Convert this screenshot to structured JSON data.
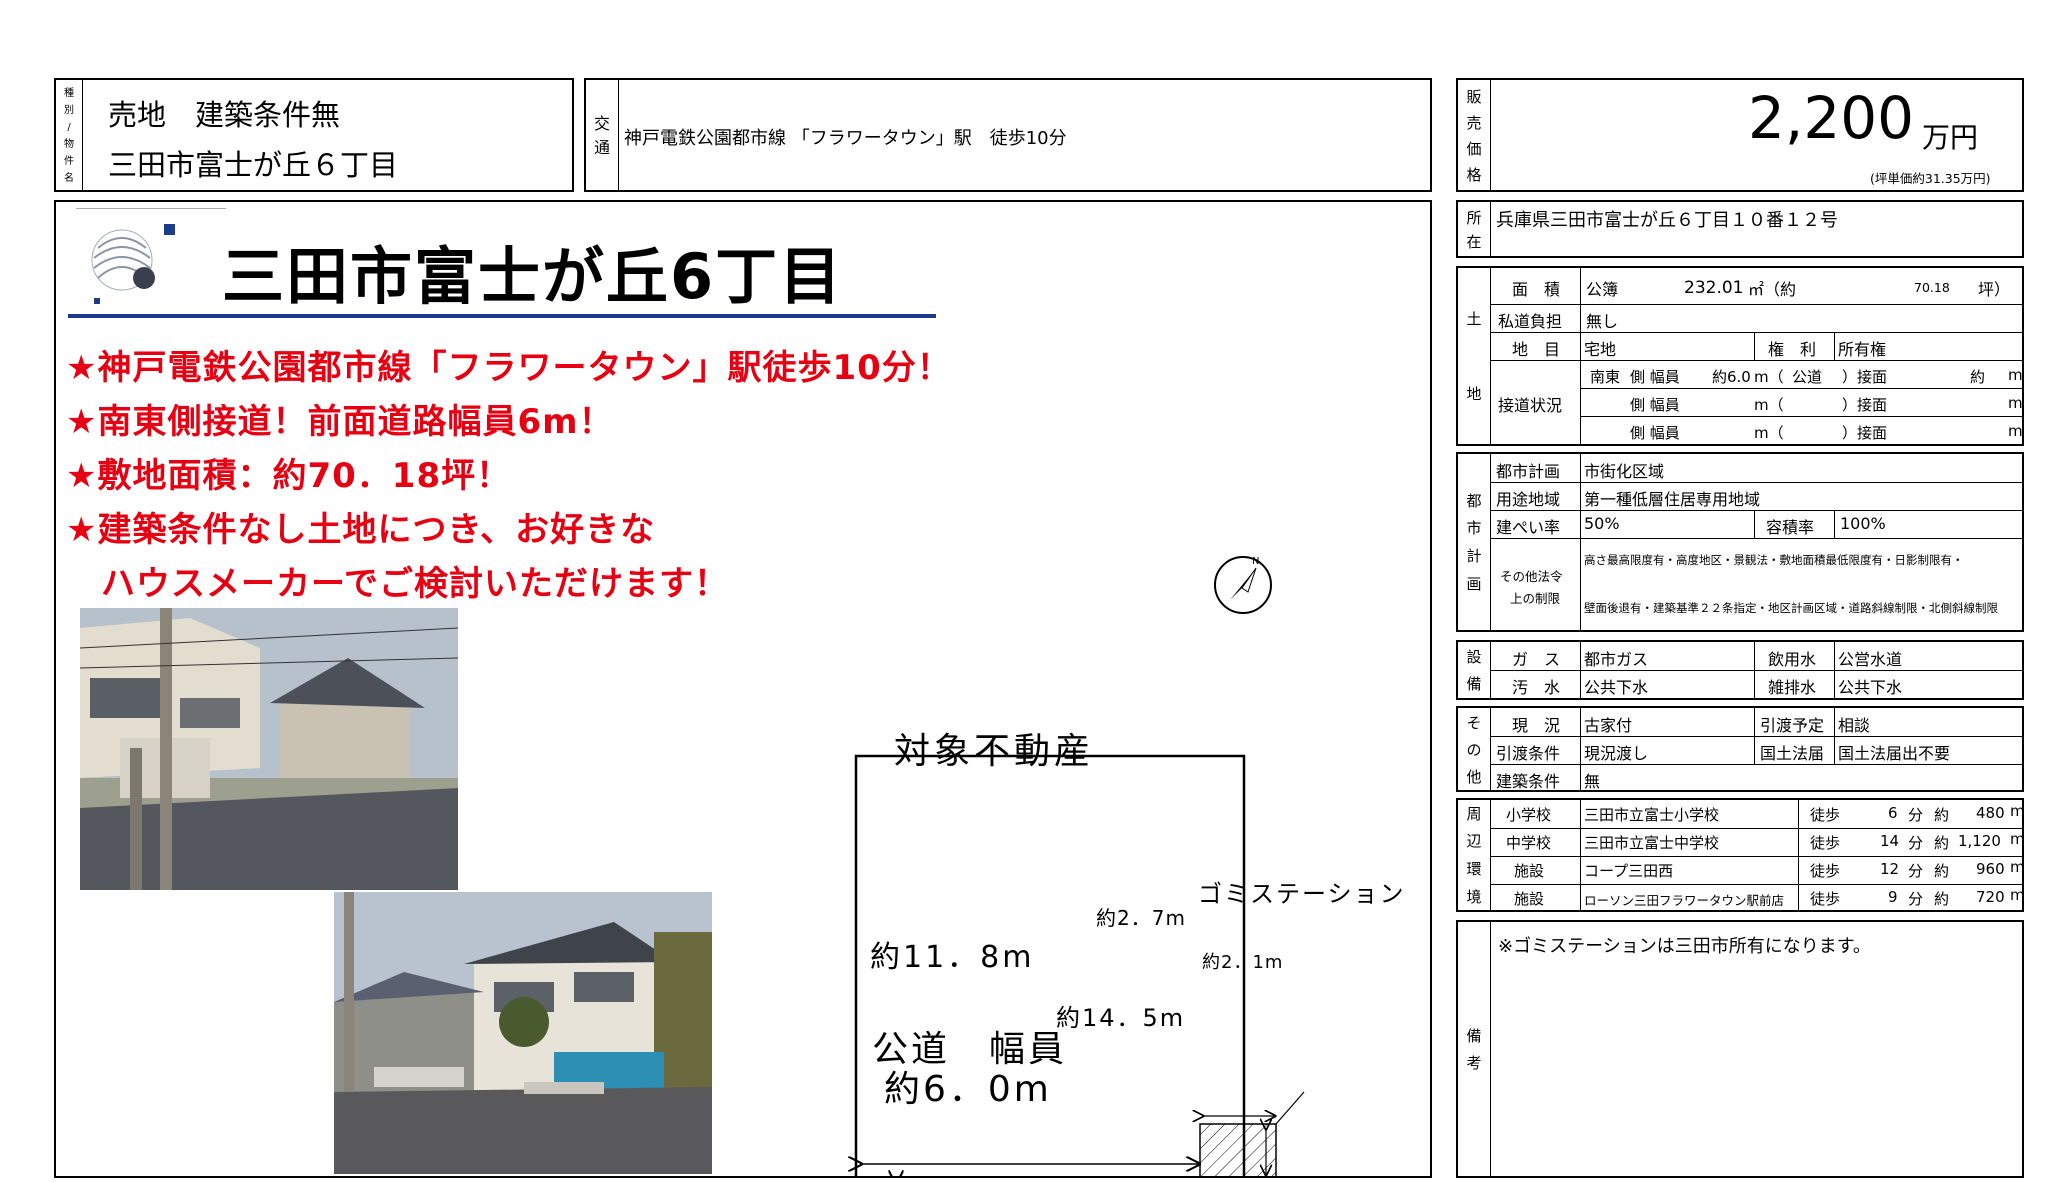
{
  "header": {
    "kind_label_chars": [
      "種",
      "別",
      "/",
      "物",
      "件",
      "名"
    ],
    "type": "売地　建築条件無",
    "name": "三田市富士が丘６丁目",
    "access_label_chars": [
      "交",
      "通"
    ],
    "access": "神戸電鉄公園都市線 「フラワータウン」駅　徒歩10分",
    "price_label_chars": [
      "販",
      "売",
      "価",
      "格"
    ],
    "price": "2,200",
    "price_unit": "万円",
    "price_note": "(坪単価約31.35万円)"
  },
  "main": {
    "title": "三田市富士が丘6丁目",
    "highlights": [
      "★神戸電鉄公園都市線「フラワータウン」駅徒歩10分！",
      "★南東側接道！前面道路幅員6m！",
      "★敷地面積：約70．18坪！",
      "★建築条件なし土地につき、お好きな",
      "　ハウスメーカーでご検討いただけます！"
    ],
    "plot_label": "対象不動産",
    "gomi_label": "ゴミステーション",
    "dim_width": "約11．8m",
    "dim_total": "約14．5m",
    "dim_gomi_w": "約2．7m",
    "dim_gomi_h": "約2．1m",
    "road_label1": "公道　幅員",
    "road_label2": "約6．0m",
    "compass_letter": "N"
  },
  "location": {
    "label_chars": [
      "所",
      "在"
    ],
    "value": "兵庫県三田市富士が丘６丁目１０番１２号"
  },
  "land": {
    "label_chars": [
      "土",
      "地"
    ],
    "area_label": "面　積",
    "area_type": "公簿",
    "area_value": "232.01",
    "area_unit": "㎡（約",
    "tsubo_value": "70.18",
    "tsubo_unit": "坪）",
    "private_road_label": "私道負担",
    "private_road_value": "無し",
    "chimoku_label": "地　目",
    "chimoku_value": "宅地",
    "rights_label": "権　利",
    "rights_value": "所有権",
    "road_label": "接道状況",
    "road_rows": [
      {
        "dir": "南東",
        "side": "側 幅員",
        "width": "約6.0",
        "m": "m（",
        "type": "公道",
        "close": "）接面",
        "approx": "約",
        "m2": "m"
      },
      {
        "dir": "",
        "side": "側 幅員",
        "width": "",
        "m": "m（",
        "type": "",
        "close": "）接面",
        "approx": "",
        "m2": "m"
      },
      {
        "dir": "",
        "side": "側 幅員",
        "width": "",
        "m": "m（",
        "type": "",
        "close": "）接面",
        "approx": "",
        "m2": "m"
      }
    ]
  },
  "plan": {
    "label_chars": [
      "都",
      "市",
      "計",
      "画"
    ],
    "city_plan_label": "都市計画",
    "city_plan_value": "市街化区域",
    "zoning_label": "用途地域",
    "zoning_value": "第一種低層住居専用地域",
    "bcr_label": "建ぺい率",
    "bcr_value": "50%",
    "far_label": "容積率",
    "far_value": "100%",
    "other_label1": "その他法令",
    "other_label2": "上の制限",
    "other_value1": "高さ最高限度有・高度地区・景観法・敷地面積最低限度有・日影制限有・",
    "other_value2": "壁面後退有・建築基準２２条指定・地区計画区域・道路斜線制限・北側斜線制限"
  },
  "facilities": {
    "label_chars": [
      "設",
      "備"
    ],
    "gas_label": "ガ　ス",
    "gas_value": "都市ガス",
    "water_label": "飲用水",
    "water_value": "公営水道",
    "sewage_label": "汚　水",
    "sewage_value": "公共下水",
    "drain_label": "雑排水",
    "drain_value": "公共下水"
  },
  "other": {
    "label_chars": [
      "そ",
      "の",
      "他"
    ],
    "status_label": "現　況",
    "status_value": "古家付",
    "handover_plan_label": "引渡予定",
    "handover_plan_value": "相談",
    "handover_cond_label": "引渡条件",
    "handover_cond_value": "現況渡し",
    "land_law_label": "国土法届",
    "land_law_value": "国土法届出不要",
    "build_cond_label": "建築条件",
    "build_cond_value": "無"
  },
  "surroundings": {
    "label_chars": [
      "周",
      "辺",
      "環",
      "境"
    ],
    "rows": [
      {
        "type": "小学校",
        "name": "三田市立富士小学校",
        "walk": "徒歩",
        "min": "6",
        "min_unit": "分",
        "approx": "約",
        "dist": "480",
        "unit": "m"
      },
      {
        "type": "中学校",
        "name": "三田市立富士中学校",
        "walk": "徒歩",
        "min": "14",
        "min_unit": "分",
        "approx": "約",
        "dist": "1,120",
        "unit": "m"
      },
      {
        "type": "施設",
        "name": "コープ三田西",
        "walk": "徒歩",
        "min": "12",
        "min_unit": "分",
        "approx": "約",
        "dist": "960",
        "unit": "m"
      },
      {
        "type": "施設",
        "name": "ローソン三田フラワータウン駅前店",
        "walk": "徒歩",
        "min": "9",
        "min_unit": "分",
        "approx": "約",
        "dist": "720",
        "unit": "m"
      }
    ]
  },
  "remarks": {
    "label_chars": [
      "備",
      "考"
    ],
    "text": "※ゴミステーションは三田市所有になります。"
  }
}
